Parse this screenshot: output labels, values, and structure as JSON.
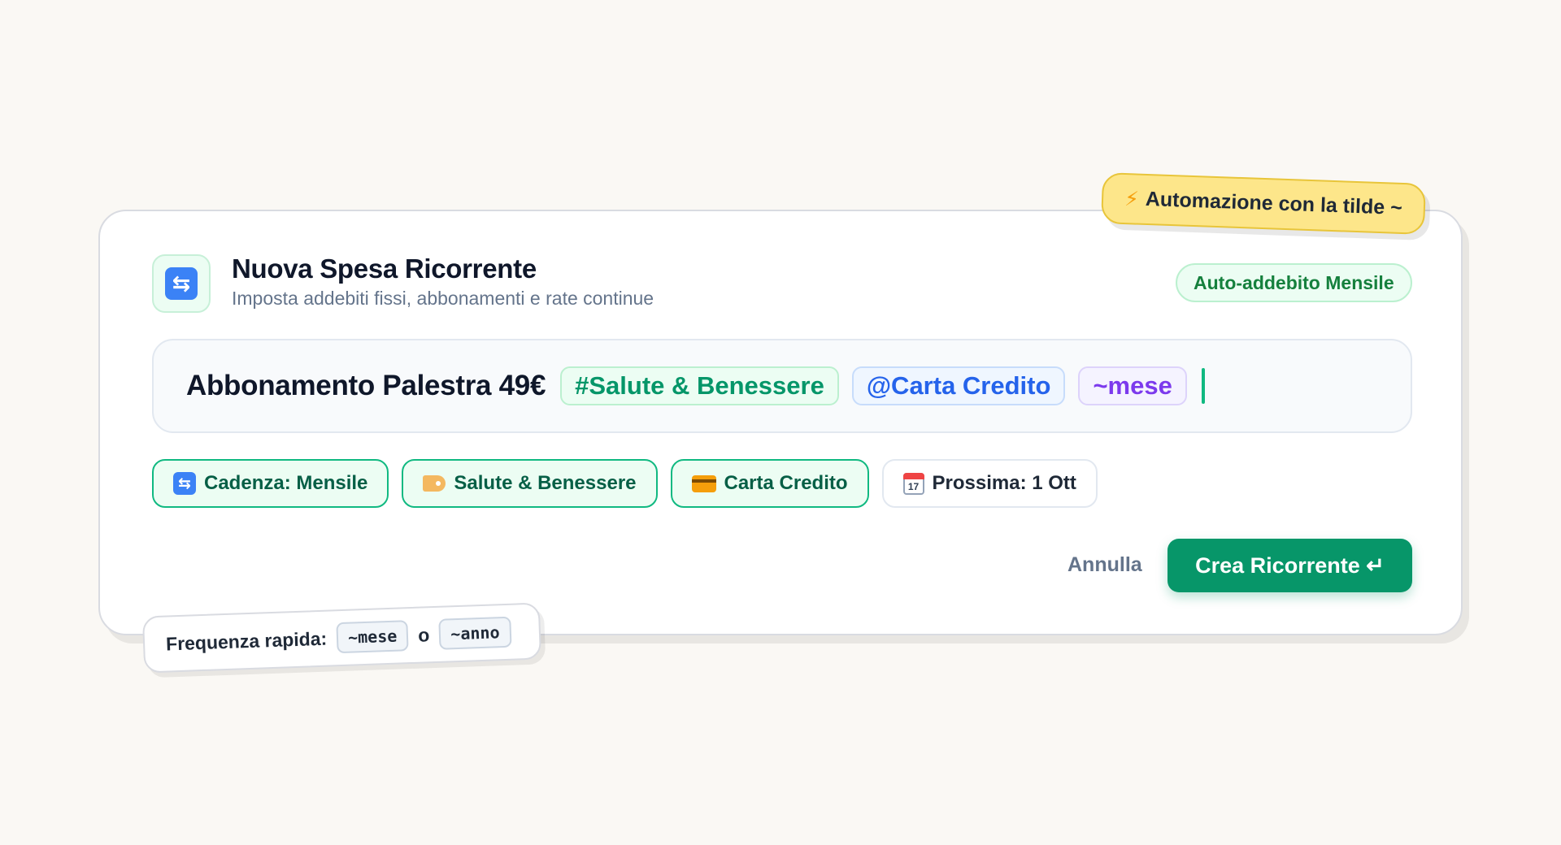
{
  "sticker_top": {
    "icon": "lightning-icon",
    "text": "Automazione con la tilde ~"
  },
  "header": {
    "icon": "refresh-icon",
    "title": "Nuova Spesa Ricorrente",
    "subtitle": "Imposta addebiti fissi, abbonamenti e rate continue",
    "badge": "Auto-addebito Mensile"
  },
  "input": {
    "text": "Abbonamento Palestra 49€",
    "tokens": {
      "category": "#Salute & Benessere",
      "account": "@Carta Credito",
      "frequency": "~mese"
    }
  },
  "chips": [
    {
      "icon": "refresh-icon",
      "label": "Cadenza: Mensile"
    },
    {
      "icon": "tag-icon",
      "label": "Salute & Benessere"
    },
    {
      "icon": "credit-card-icon",
      "label": "Carta Credito"
    },
    {
      "icon": "calendar-icon",
      "label": "Prossima: 1 Ott",
      "calendar_day": "17"
    }
  ],
  "actions": {
    "cancel": "Annulla",
    "create": "Crea Ricorrente ↵"
  },
  "sticker_bottom": {
    "label": "Frequenza rapida:",
    "key1": "~mese",
    "separator": "o",
    "key2": "~anno"
  },
  "colors": {
    "primary": "#079669",
    "category_token": "#059669",
    "account_token": "#2563eb",
    "frequency_token": "#7c3aed",
    "sticker": "#fde68a"
  }
}
